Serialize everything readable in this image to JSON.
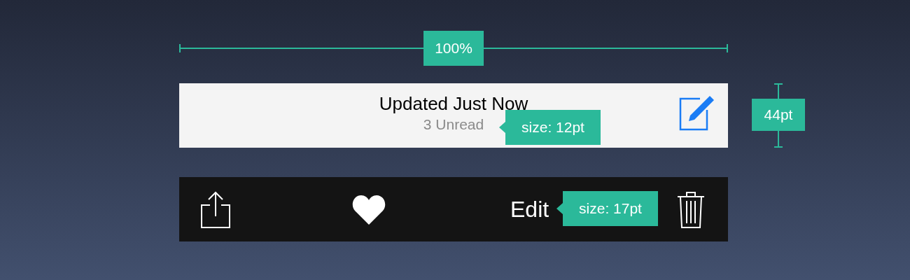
{
  "width_marker": {
    "label": "100%"
  },
  "navigation_bar": {
    "title": "Updated Just Now",
    "subtitle": "3 Unread",
    "annotation": "size: 12pt"
  },
  "height_marker": {
    "label": "44pt"
  },
  "toolbar": {
    "edit": "Edit",
    "annotation": "size: 17pt"
  }
}
